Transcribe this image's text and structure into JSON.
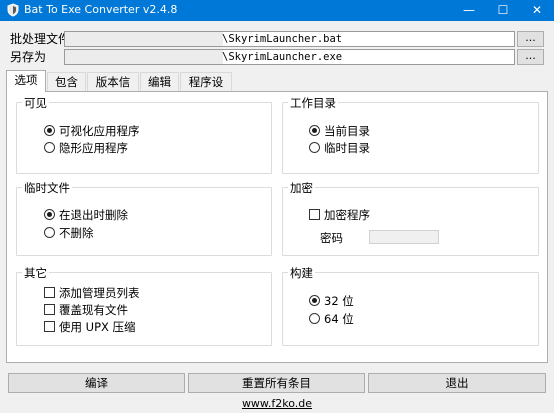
{
  "window": {
    "title": "Bat To Exe Converter v2.4.8",
    "minimize_glyph": "—",
    "maximize_glyph": "☐",
    "close_glyph": "✕"
  },
  "batch_file": {
    "label": "批处理文件",
    "value_suffix": "\\SkyrimLauncher.bat",
    "browse": "..."
  },
  "save_as": {
    "label": "另存为",
    "value_suffix": "\\SkyrimLauncher.exe",
    "browse": "..."
  },
  "tabs": [
    "选项",
    "包含",
    "版本信息",
    "编辑器",
    "程序设置"
  ],
  "groups": {
    "visibility": {
      "title": "可见",
      "options": [
        "可视化应用程序",
        "隐形应用程序"
      ],
      "selected": 0
    },
    "workdir": {
      "title": "工作目录",
      "options": [
        "当前目录",
        "临时目录"
      ],
      "selected": 0
    },
    "tempfiles": {
      "title": "临时文件",
      "options": [
        "在退出时删除",
        "不删除"
      ],
      "selected": 0
    },
    "encryption": {
      "title": "加密",
      "checkbox": "加密程序",
      "password_label": "密码"
    },
    "other": {
      "title": "其它",
      "checkboxes": [
        "添加管理员列表",
        "覆盖现有文件",
        "使用 UPX 压缩"
      ]
    },
    "build": {
      "title": "构建",
      "options": [
        "32 位",
        "64 位"
      ],
      "selected": 0
    }
  },
  "buttons": {
    "compile": "编译",
    "reset": "重置所有条目",
    "exit": "退出"
  },
  "footer": {
    "link": "www.f2ko.de"
  },
  "colors": {
    "titlebar": "#0078d7",
    "window_bg": "#f0f0f0",
    "panel_bg": "#ffffff"
  },
  "icons": [
    "app-shield-icon",
    "minimize-icon",
    "maximize-icon",
    "close-icon"
  ]
}
